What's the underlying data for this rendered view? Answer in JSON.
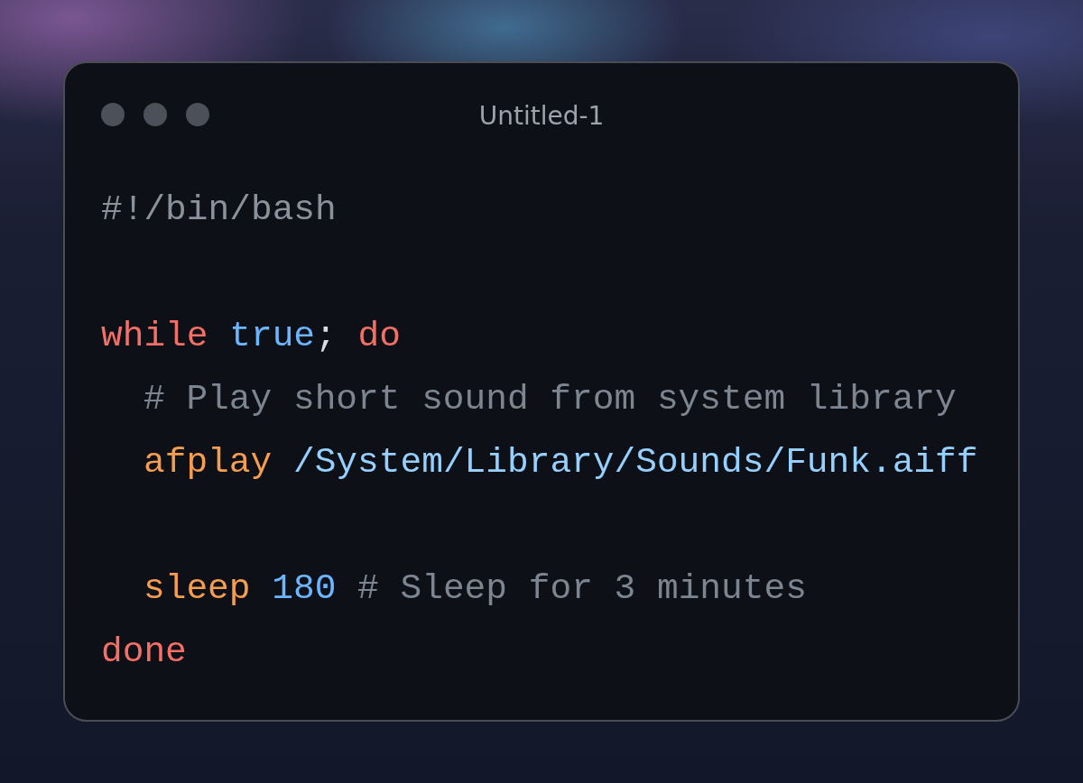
{
  "window": {
    "title": "Untitled-1"
  },
  "code": [
    {
      "kind": "code",
      "indent": false,
      "tokens": [
        {
          "kind": "shebang",
          "text": "#!/bin/bash"
        }
      ]
    },
    {
      "kind": "blank"
    },
    {
      "kind": "code",
      "indent": false,
      "tokens": [
        {
          "kind": "keyword",
          "text": "while"
        },
        {
          "kind": "builtin",
          "text": "true"
        },
        {
          "kind": "punct",
          "text": ";"
        },
        {
          "kind": "keyword",
          "text": "do"
        }
      ]
    },
    {
      "kind": "code",
      "indent": true,
      "tokens": [
        {
          "kind": "comment",
          "text": "# Play short sound from system library"
        }
      ]
    },
    {
      "kind": "code",
      "indent": true,
      "tokens": [
        {
          "kind": "command",
          "text": "afplay"
        },
        {
          "kind": "path",
          "text": "/System/Library/Sounds/Funk.aiff"
        }
      ]
    },
    {
      "kind": "blank"
    },
    {
      "kind": "code",
      "indent": true,
      "tokens": [
        {
          "kind": "command",
          "text": "sleep"
        },
        {
          "kind": "number",
          "text": "180"
        },
        {
          "kind": "comment",
          "text": "# Sleep for 3 minutes"
        }
      ]
    },
    {
      "kind": "code",
      "indent": false,
      "tokens": [
        {
          "kind": "keyword",
          "text": "done"
        }
      ]
    }
  ]
}
